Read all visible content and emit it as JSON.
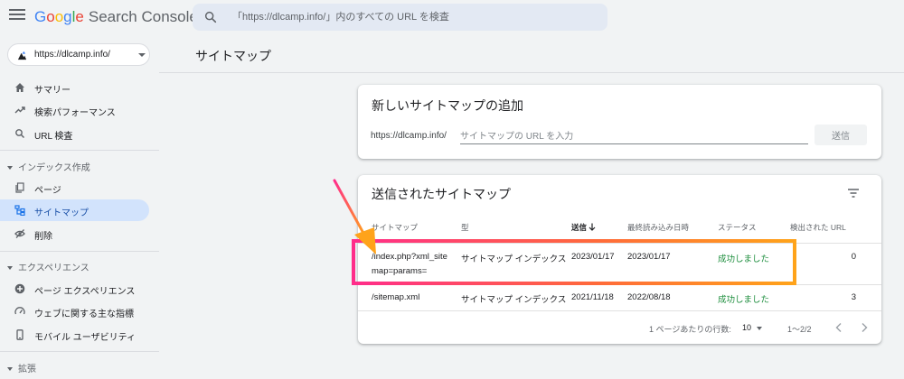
{
  "header": {
    "logo_letters": [
      "G",
      "o",
      "o",
      "g",
      "l",
      "e"
    ],
    "product": "Search Console",
    "search_placeholder": "「https://dlcamp.info/」内のすべての URL を検査"
  },
  "property": {
    "label": "https://dlcamp.info/"
  },
  "sidebar": {
    "items": [
      {
        "id": "summary",
        "label": "サマリー",
        "icon": "home-icon"
      },
      {
        "id": "performance",
        "label": "検索パフォーマンス",
        "icon": "trending-up-icon"
      },
      {
        "id": "url-inspection",
        "label": "URL 検査",
        "icon": "search-icon"
      }
    ],
    "sections": [
      {
        "title": "インデックス作成",
        "items": [
          {
            "id": "pages",
            "label": "ページ",
            "icon": "pages-icon"
          },
          {
            "id": "sitemaps",
            "label": "サイトマップ",
            "icon": "sitemap-icon",
            "active": true
          },
          {
            "id": "removals",
            "label": "削除",
            "icon": "visibility-off-icon"
          }
        ]
      },
      {
        "title": "エクスペリエンス",
        "items": [
          {
            "id": "page-experience",
            "label": "ページ エクスペリエンス",
            "icon": "add-circle-icon"
          },
          {
            "id": "core-web-vitals",
            "label": "ウェブに関する主な指標",
            "icon": "speed-icon"
          },
          {
            "id": "mobile-usability",
            "label": "モバイル ユーザビリティ",
            "icon": "phone-icon"
          }
        ]
      },
      {
        "title": "拡張",
        "items": []
      }
    ]
  },
  "page": {
    "title": "サイトマップ"
  },
  "add_sitemap": {
    "title": "新しいサイトマップの追加",
    "prefix": "https://dlcamp.info/",
    "placeholder": "サイトマップの URL を入力",
    "submit_label": "送信"
  },
  "submitted": {
    "title": "送信されたサイトマップ",
    "columns": {
      "sitemap": "サイトマップ",
      "type": "型",
      "submitted": "送信",
      "last_read": "最終読み込み日時",
      "status": "ステータス",
      "discovered": "検出された URL"
    },
    "rows": [
      {
        "sitemap_line1": "/index.php?xml_site",
        "sitemap_line2": "map=params=",
        "type": "サイトマップ インデックス",
        "submitted": "2023/01/17",
        "last_read": "2023/01/17",
        "status": "成功しました",
        "discovered": "0"
      },
      {
        "sitemap_line1": "/sitemap.xml",
        "sitemap_line2": "",
        "type": "サイトマップ インデックス",
        "submitted": "2021/11/18",
        "last_read": "2022/08/18",
        "status": "成功しました",
        "discovered": "3"
      }
    ],
    "footer": {
      "rows_per_page_label": "1 ページあたりの行数:",
      "rows_per_page": "10",
      "range": "1〜2/2"
    }
  },
  "colors": {
    "accent": "#1a73e8",
    "active_nav": "#d2e3fc",
    "success": "#1e8e3e",
    "annotation_start": "#ff2d8a",
    "annotation_end": "#ffa31a"
  }
}
